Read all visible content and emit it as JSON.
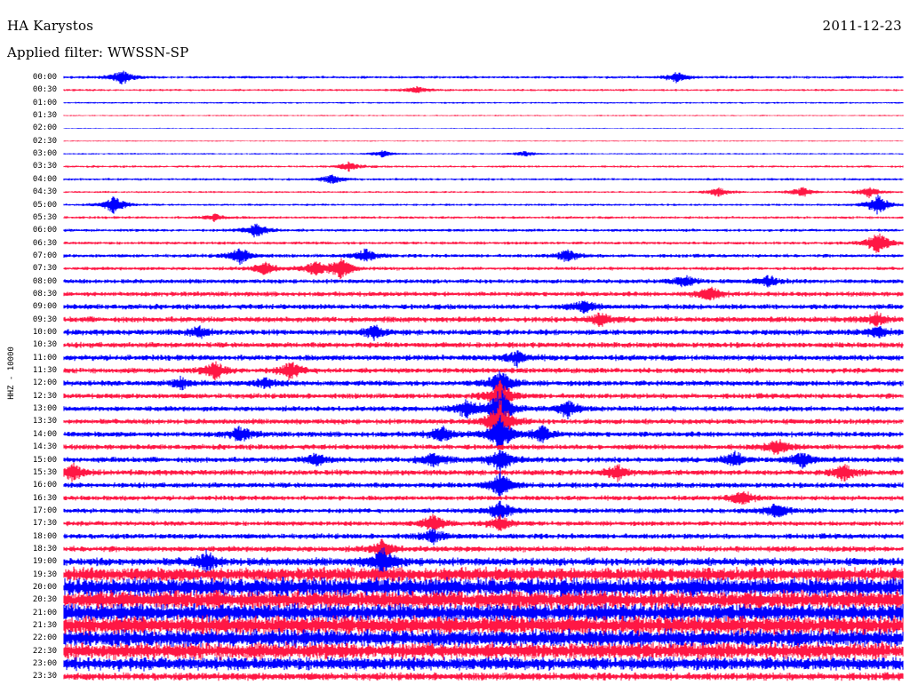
{
  "header": {
    "station": "HA Karystos",
    "date": "2011-12-23",
    "filter": "Applied filter: WWSSN-SP"
  },
  "channel_label": "HHZ - 10000",
  "colors": {
    "trace_even": "#0000ff",
    "trace_odd": "#ff1744",
    "background": "#ffffff",
    "text": "#000000"
  },
  "time_labels": [
    "00:00",
    "00:30",
    "01:00",
    "01:30",
    "02:00",
    "02:30",
    "03:00",
    "03:30",
    "04:00",
    "04:30",
    "05:00",
    "05:30",
    "06:00",
    "06:30",
    "07:00",
    "07:30",
    "08:00",
    "08:30",
    "09:00",
    "09:30",
    "10:00",
    "10:30",
    "11:00",
    "11:30",
    "12:00",
    "12:30",
    "13:00",
    "13:30",
    "14:00",
    "14:30",
    "15:00",
    "15:30",
    "16:00",
    "16:30",
    "17:00",
    "17:30",
    "18:00",
    "18:30",
    "19:00",
    "19:30",
    "20:00",
    "20:30",
    "21:00",
    "21:30",
    "22:00",
    "22:30",
    "23:00",
    "23:30"
  ],
  "noise_level": [
    1.2,
    1.0,
    0.8,
    0.6,
    0.4,
    0.5,
    0.7,
    1.0,
    1.1,
    0.9,
    1.0,
    1.2,
    1.3,
    1.4,
    1.6,
    1.6,
    2.0,
    2.2,
    2.4,
    2.6,
    2.6,
    2.5,
    2.6,
    2.4,
    2.5,
    2.4,
    2.4,
    2.4,
    2.5,
    2.4,
    2.5,
    2.6,
    2.4,
    2.2,
    2.2,
    2.2,
    2.4,
    2.6,
    3.6,
    6.5,
    8.5,
    8.5,
    8.0,
    8.5,
    8.0,
    7.5,
    6.0,
    3.5
  ],
  "events": [
    {
      "row": 0,
      "t": 0.07,
      "amp": 9
    },
    {
      "row": 0,
      "t": 0.73,
      "amp": 6
    },
    {
      "row": 1,
      "t": 0.42,
      "amp": 4
    },
    {
      "row": 6,
      "t": 0.38,
      "amp": 4
    },
    {
      "row": 6,
      "t": 0.55,
      "amp": 3
    },
    {
      "row": 7,
      "t": 0.34,
      "amp": 5
    },
    {
      "row": 8,
      "t": 0.32,
      "amp": 5
    },
    {
      "row": 9,
      "t": 0.78,
      "amp": 5
    },
    {
      "row": 9,
      "t": 0.88,
      "amp": 6
    },
    {
      "row": 9,
      "t": 0.96,
      "amp": 6
    },
    {
      "row": 10,
      "t": 0.06,
      "amp": 11
    },
    {
      "row": 10,
      "t": 0.97,
      "amp": 12
    },
    {
      "row": 11,
      "t": 0.18,
      "amp": 4
    },
    {
      "row": 12,
      "t": 0.23,
      "amp": 9
    },
    {
      "row": 13,
      "t": 0.97,
      "amp": 14
    },
    {
      "row": 14,
      "t": 0.21,
      "amp": 10
    },
    {
      "row": 14,
      "t": 0.36,
      "amp": 8
    },
    {
      "row": 14,
      "t": 0.6,
      "amp": 7
    },
    {
      "row": 15,
      "t": 0.24,
      "amp": 8
    },
    {
      "row": 15,
      "t": 0.3,
      "amp": 8
    },
    {
      "row": 15,
      "t": 0.33,
      "amp": 12
    },
    {
      "row": 16,
      "t": 0.74,
      "amp": 7
    },
    {
      "row": 16,
      "t": 0.84,
      "amp": 6
    },
    {
      "row": 17,
      "t": 0.77,
      "amp": 8
    },
    {
      "row": 18,
      "t": 0.62,
      "amp": 7
    },
    {
      "row": 19,
      "t": 0.64,
      "amp": 8
    },
    {
      "row": 19,
      "t": 0.97,
      "amp": 7
    },
    {
      "row": 20,
      "t": 0.16,
      "amp": 6
    },
    {
      "row": 20,
      "t": 0.37,
      "amp": 7
    },
    {
      "row": 20,
      "t": 0.97,
      "amp": 7
    },
    {
      "row": 22,
      "t": 0.54,
      "amp": 8
    },
    {
      "row": 23,
      "t": 0.18,
      "amp": 10
    },
    {
      "row": 23,
      "t": 0.27,
      "amp": 10
    },
    {
      "row": 24,
      "t": 0.14,
      "amp": 6
    },
    {
      "row": 24,
      "t": 0.24,
      "amp": 6
    },
    {
      "row": 24,
      "t": 0.52,
      "amp": 16
    },
    {
      "row": 25,
      "t": 0.52,
      "amp": 18
    },
    {
      "row": 26,
      "t": 0.48,
      "amp": 10
    },
    {
      "row": 26,
      "t": 0.52,
      "amp": 24
    },
    {
      "row": 26,
      "t": 0.6,
      "amp": 10
    },
    {
      "row": 27,
      "t": 0.52,
      "amp": 26
    },
    {
      "row": 28,
      "t": 0.21,
      "amp": 9
    },
    {
      "row": 28,
      "t": 0.45,
      "amp": 9
    },
    {
      "row": 28,
      "t": 0.52,
      "amp": 22
    },
    {
      "row": 28,
      "t": 0.57,
      "amp": 9
    },
    {
      "row": 29,
      "t": 0.85,
      "amp": 9
    },
    {
      "row": 30,
      "t": 0.3,
      "amp": 7
    },
    {
      "row": 30,
      "t": 0.44,
      "amp": 9
    },
    {
      "row": 30,
      "t": 0.52,
      "amp": 14
    },
    {
      "row": 30,
      "t": 0.8,
      "amp": 8
    },
    {
      "row": 30,
      "t": 0.88,
      "amp": 9
    },
    {
      "row": 31,
      "t": 0.01,
      "amp": 9
    },
    {
      "row": 31,
      "t": 0.66,
      "amp": 8
    },
    {
      "row": 31,
      "t": 0.93,
      "amp": 9
    },
    {
      "row": 32,
      "t": 0.52,
      "amp": 14
    },
    {
      "row": 33,
      "t": 0.81,
      "amp": 9
    },
    {
      "row": 34,
      "t": 0.52,
      "amp": 12
    },
    {
      "row": 34,
      "t": 0.85,
      "amp": 9
    },
    {
      "row": 35,
      "t": 0.44,
      "amp": 10
    },
    {
      "row": 35,
      "t": 0.52,
      "amp": 9
    },
    {
      "row": 36,
      "t": 0.44,
      "amp": 8
    },
    {
      "row": 37,
      "t": 0.38,
      "amp": 10
    },
    {
      "row": 38,
      "t": 0.17,
      "amp": 10
    },
    {
      "row": 38,
      "t": 0.38,
      "amp": 14
    }
  ]
}
